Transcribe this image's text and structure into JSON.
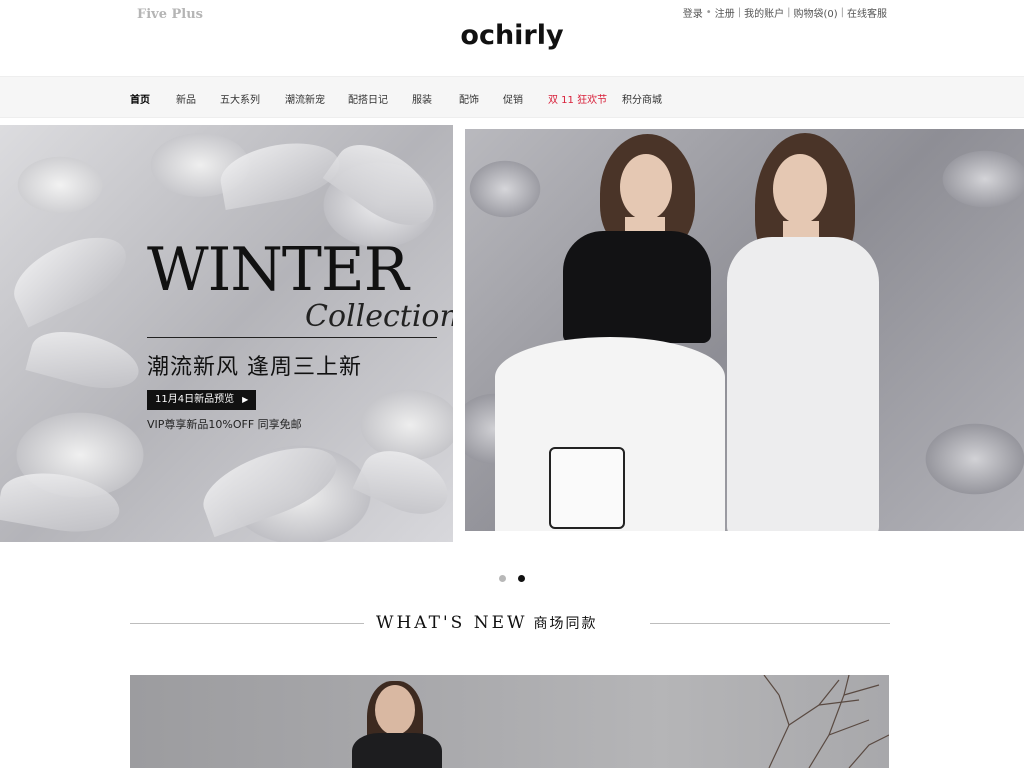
{
  "header": {
    "sister_brand": "Five Plus",
    "logo": "ochirly",
    "util_links": {
      "login": "登录",
      "register": "注册",
      "account": "我的账户",
      "cart": "购物袋(0)",
      "service": "在线客服"
    }
  },
  "nav": {
    "items": [
      {
        "label": "首页"
      },
      {
        "label": "新品"
      },
      {
        "label": "五大系列"
      },
      {
        "label": "潮流新宠"
      },
      {
        "label": "配搭日记"
      },
      {
        "label": "服装"
      },
      {
        "label": "配饰"
      },
      {
        "label": "促销"
      },
      {
        "label": "双 11 狂欢节"
      },
      {
        "label": "积分商城"
      }
    ],
    "active_index": 0,
    "highlight_index": 8,
    "highlight_color": "#d8203a"
  },
  "hero": {
    "title": "WINTER",
    "subtitle": "Collection",
    "slogan": "潮流新风  逢周三上新",
    "badge": "11月4日新品预览",
    "vip": "VIP尊享新品10%OFF 同享免邮",
    "slide_count": 2,
    "active_slide": 1
  },
  "section": {
    "title_en": "WHAT'S  NEW",
    "title_cn": "商场同款"
  },
  "colors": {
    "accent": "#d8203a",
    "text": "#222222",
    "nav_bg": "#f6f6f6"
  },
  "icons": {
    "badge_arrow": "play-arrow-icon"
  }
}
